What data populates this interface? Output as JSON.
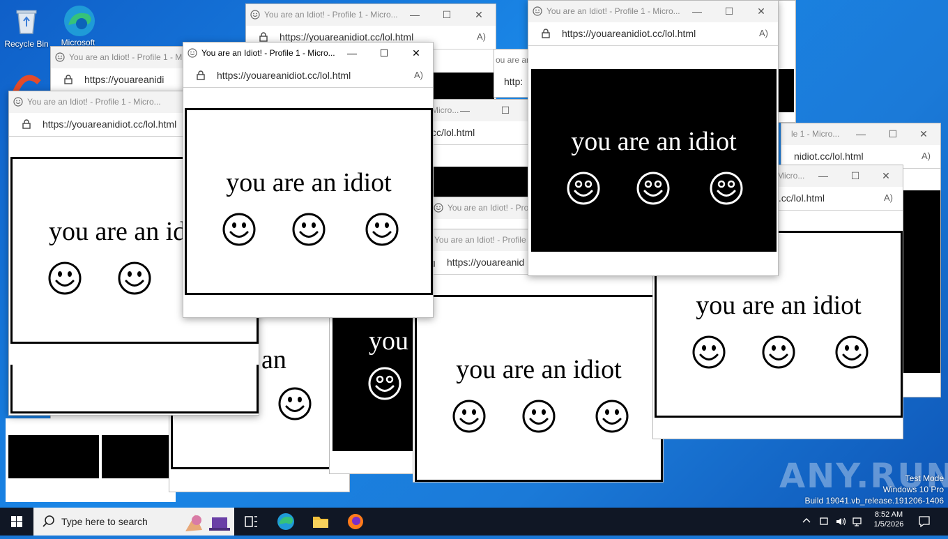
{
  "desktop": {
    "icons": [
      {
        "label": "Recycle Bin"
      },
      {
        "label": "Microsoft"
      }
    ]
  },
  "browser": {
    "title": "You are an Idiot! - Profile 1 - Microsoft Edge",
    "title_partials": {
      "t1": "You are an Idiot! - Profile 1 - Micro...",
      "t2": "You are an Idiot! - Profile 1 - Mi",
      "t3": "You are an Idiot! - Profile 1 - Micro...",
      "t4": "Micro...",
      "t5": "You are an Idiot! - Pro",
      "t6": "You are an Idiot! - Profile 1",
      "t7": "le 1 - Micro...",
      "t8": "Micro..."
    },
    "url": "https://youareanidiot.cc/lol.html",
    "url_partials": {
      "u1": "https://youareanidi",
      "u2": "https://youareanidiot.cc/lol.html",
      "u3": "cc/lol.html",
      "u4": "https://youareanid",
      "u5": "nidiot.cc/lol.html",
      "u6": "t.cc/lol.html",
      "u7": "ou are an",
      "u8": "http:"
    },
    "read_aloud": "A)",
    "page_text": "you are an idiot",
    "page_text_partials": {
      "p1": "you are an id",
      "p2": "are an",
      "p3": "you"
    }
  },
  "taskbar": {
    "search_placeholder": "Type here to search",
    "time": "8:52 AM",
    "date": "1/5/2026"
  },
  "watermark": {
    "line1": "Test Mode",
    "line2": "Windows 10 Pro",
    "line3": "Build 19041.vb_release.191206-1406",
    "brand": "ANY.RUN"
  }
}
